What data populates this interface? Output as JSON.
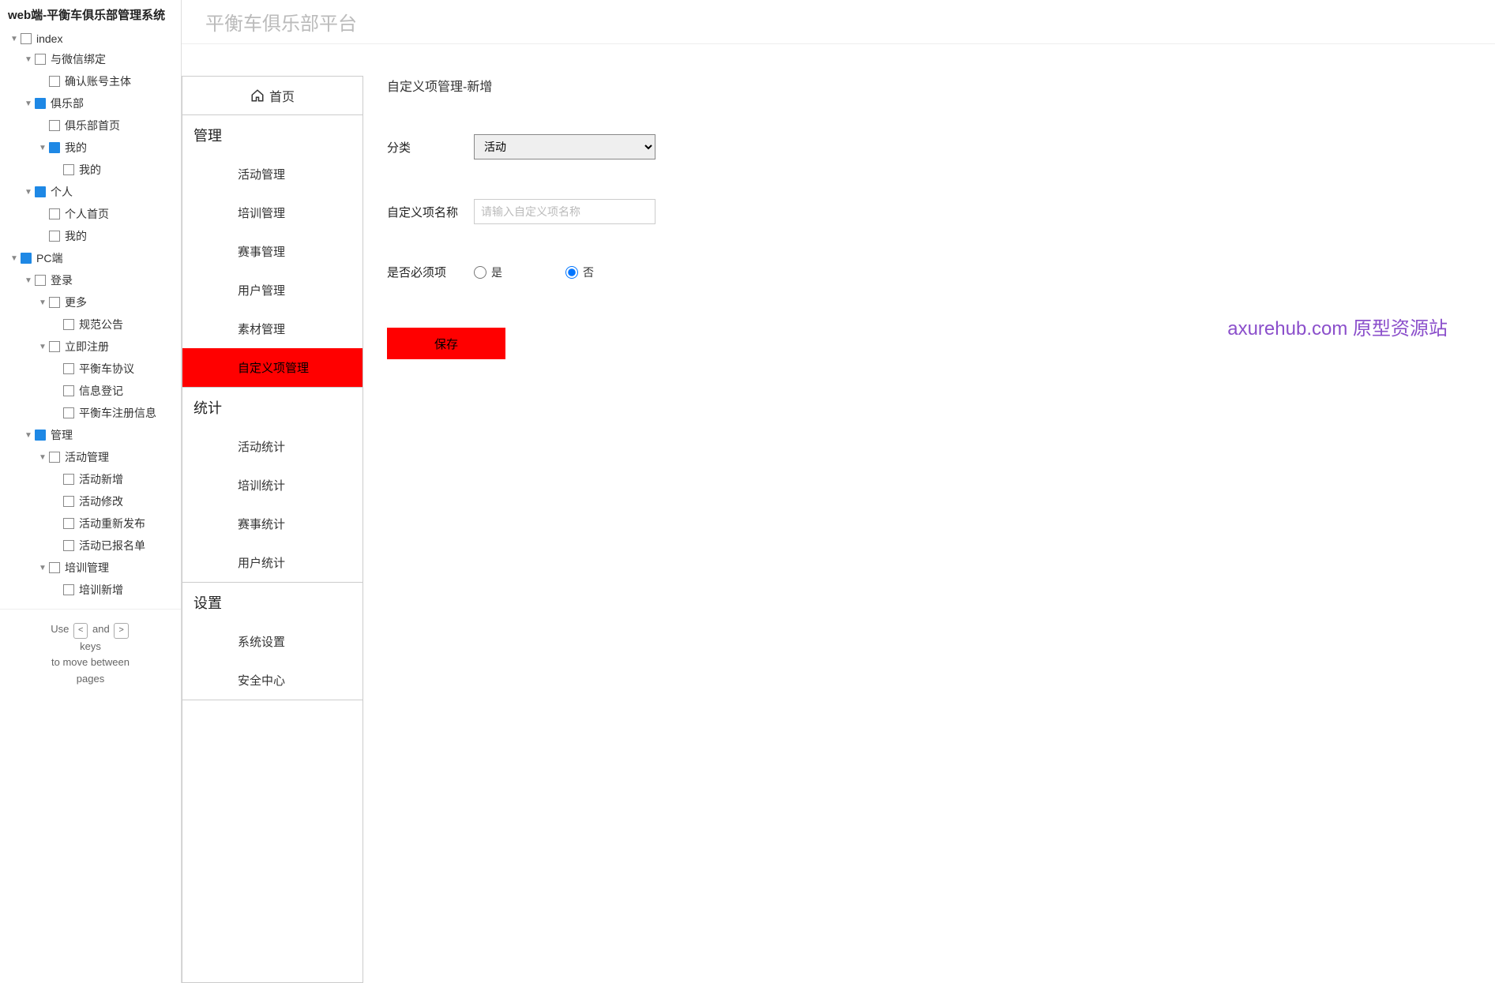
{
  "tree": {
    "title": "web端-平衡车俱乐部管理系统",
    "nodes": [
      {
        "label": "index",
        "icon": "page",
        "indent": 1,
        "caret": "▼"
      },
      {
        "label": "与微信绑定",
        "icon": "page",
        "indent": 2,
        "caret": "▼"
      },
      {
        "label": "确认账号主体",
        "icon": "page",
        "indent": 3,
        "caret": ""
      },
      {
        "label": "俱乐部",
        "icon": "folder",
        "indent": 2,
        "caret": "▼"
      },
      {
        "label": "俱乐部首页",
        "icon": "page",
        "indent": 3,
        "caret": ""
      },
      {
        "label": "我的",
        "icon": "folder",
        "indent": 3,
        "caret": "▼"
      },
      {
        "label": "我的",
        "icon": "page",
        "indent": 4,
        "caret": ""
      },
      {
        "label": "个人",
        "icon": "folder",
        "indent": 2,
        "caret": "▼"
      },
      {
        "label": "个人首页",
        "icon": "page",
        "indent": 3,
        "caret": ""
      },
      {
        "label": "我的",
        "icon": "page",
        "indent": 3,
        "caret": ""
      },
      {
        "label": "PC端",
        "icon": "folder",
        "indent": 1,
        "caret": "▼"
      },
      {
        "label": "登录",
        "icon": "page",
        "indent": 2,
        "caret": "▼"
      },
      {
        "label": "更多",
        "icon": "page",
        "indent": 3,
        "caret": "▼"
      },
      {
        "label": "规范公告",
        "icon": "page",
        "indent": 4,
        "caret": ""
      },
      {
        "label": "立即注册",
        "icon": "page",
        "indent": 3,
        "caret": "▼"
      },
      {
        "label": "平衡车协议",
        "icon": "page",
        "indent": 4,
        "caret": ""
      },
      {
        "label": "信息登记",
        "icon": "page",
        "indent": 4,
        "caret": ""
      },
      {
        "label": "平衡车注册信息",
        "icon": "page",
        "indent": 4,
        "caret": ""
      },
      {
        "label": "管理",
        "icon": "folder",
        "indent": 2,
        "caret": "▼"
      },
      {
        "label": "活动管理",
        "icon": "page",
        "indent": 3,
        "caret": "▼"
      },
      {
        "label": "活动新增",
        "icon": "page",
        "indent": 4,
        "caret": ""
      },
      {
        "label": "活动修改",
        "icon": "page",
        "indent": 4,
        "caret": ""
      },
      {
        "label": "活动重新发布",
        "icon": "page",
        "indent": 4,
        "caret": ""
      },
      {
        "label": "活动已报名单",
        "icon": "page",
        "indent": 4,
        "caret": ""
      },
      {
        "label": "培训管理",
        "icon": "page",
        "indent": 3,
        "caret": "▼"
      },
      {
        "label": "培训新增",
        "icon": "page",
        "indent": 4,
        "caret": ""
      }
    ],
    "footer": {
      "line1a": "Use",
      "key1": "<",
      "line1b": "and",
      "key2": ">",
      "line2": "keys",
      "line3": "to move between",
      "line4": "pages"
    }
  },
  "header": {
    "title": "平衡车俱乐部平台"
  },
  "innerNav": {
    "home": "首页",
    "sections": [
      {
        "title": "管理",
        "items": [
          "活动管理",
          "培训管理",
          "赛事管理",
          "用户管理",
          "素材管理",
          "自定义项管理"
        ],
        "activeIndex": 5
      },
      {
        "title": "统计",
        "items": [
          "活动统计",
          "培训统计",
          "赛事统计",
          "用户统计"
        ],
        "activeIndex": -1
      },
      {
        "title": "设置",
        "items": [
          "系统设置",
          "安全中心"
        ],
        "activeIndex": -1
      }
    ]
  },
  "form": {
    "title": "自定义项管理-新增",
    "category": {
      "label": "分类",
      "value": "活动"
    },
    "name": {
      "label": "自定义项名称",
      "placeholder": "请输入自定义项名称"
    },
    "required": {
      "label": "是否必须项",
      "yes": "是",
      "no": "否",
      "selected": "no"
    },
    "save": "保存"
  },
  "watermark": "axurehub.com 原型资源站"
}
